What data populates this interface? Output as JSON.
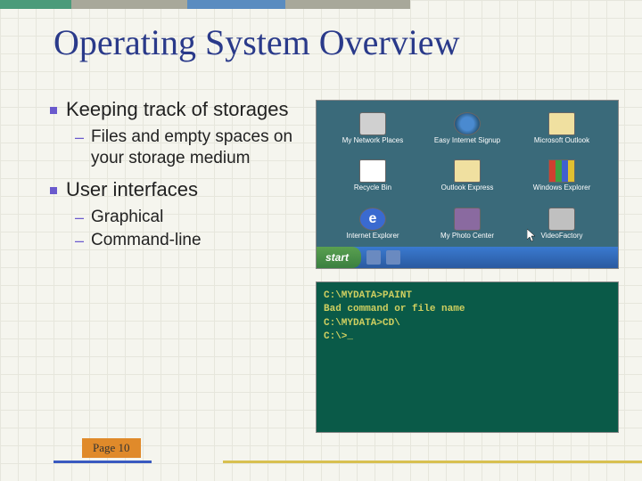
{
  "title": "Operating System Overview",
  "bullets": [
    {
      "text": "Keeping track of storages",
      "subs": [
        "Files and empty spaces on your storage medium"
      ]
    },
    {
      "text": "User interfaces",
      "subs": [
        "Graphical",
        "Command-line"
      ]
    }
  ],
  "page_label": "Page 10",
  "desktop": {
    "icons": [
      {
        "name": "network-places-icon",
        "label": "My Network Places",
        "cls": "monitor"
      },
      {
        "name": "easy-internet-icon",
        "label": "Easy Internet Signup",
        "cls": "globe"
      },
      {
        "name": "outlook-icon",
        "label": "Microsoft Outlook",
        "cls": "envelope"
      },
      {
        "name": "recycle-bin-icon",
        "label": "Recycle Bin",
        "cls": "bin"
      },
      {
        "name": "outlook-express-icon",
        "label": "Outlook Express",
        "cls": "envelope"
      },
      {
        "name": "windows-explorer-icon",
        "label": "Windows Explorer",
        "cls": "flag"
      },
      {
        "name": "ie-icon",
        "label": "Internet Explorer",
        "cls": "ie"
      },
      {
        "name": "photo-center-icon",
        "label": "My Photo Center",
        "cls": "photo"
      },
      {
        "name": "videofactory-icon",
        "label": "VideoFactory",
        "cls": "cam"
      }
    ],
    "start_label": "start"
  },
  "terminal": {
    "lines": [
      "C:\\MYDATA>PAINT",
      "Bad command or file name",
      "",
      "C:\\MYDATA>CD\\",
      "",
      "C:\\>_"
    ]
  }
}
